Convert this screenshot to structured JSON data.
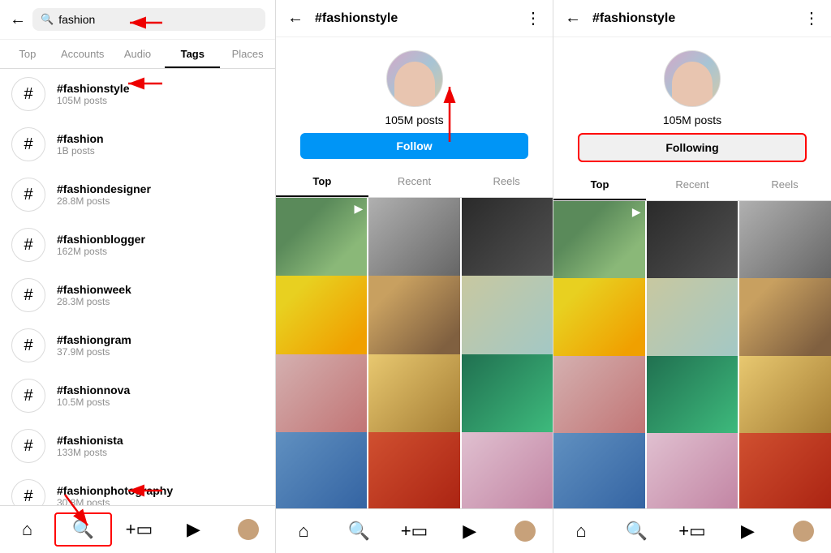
{
  "left": {
    "search_value": "fashion",
    "nav_tabs": [
      "Top",
      "Accounts",
      "Audio",
      "Tags",
      "Places"
    ],
    "active_tab": "Tags",
    "tags": [
      {
        "name": "#fashionstyle",
        "posts": "105M posts"
      },
      {
        "name": "#fashion",
        "posts": "1B posts"
      },
      {
        "name": "#fashiondesigner",
        "posts": "28.8M posts"
      },
      {
        "name": "#fashionblogger",
        "posts": "162M posts"
      },
      {
        "name": "#fashionweek",
        "posts": "28.3M posts"
      },
      {
        "name": "#fashiongram",
        "posts": "37.9M posts"
      },
      {
        "name": "#fashionnova",
        "posts": "10.5M posts"
      },
      {
        "name": "#fashionista",
        "posts": "133M posts"
      },
      {
        "name": "#fashionphotography",
        "posts": "30.8M posts"
      }
    ]
  },
  "mid": {
    "title": "#fashionstyle",
    "posts_count": "105M posts",
    "follow_label": "Follow",
    "tabs": [
      "Top",
      "Recent",
      "Reels"
    ]
  },
  "right": {
    "title": "#fashionstyle",
    "posts_count": "105M posts",
    "following_label": "Following",
    "tabs": [
      "Top",
      "Recent",
      "Reels"
    ]
  },
  "bottom_nav": {
    "items": [
      "home",
      "search",
      "add",
      "reels",
      "profile"
    ]
  }
}
